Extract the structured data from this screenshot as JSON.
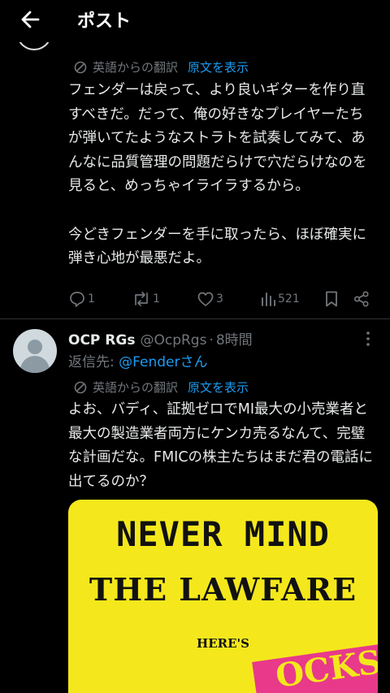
{
  "header": {
    "title": "ポスト"
  },
  "tweet1": {
    "translated_label": "英語からの翻訳",
    "show_original": "原文を表示",
    "text": "フェンダーは戻って、より良いギターを作り直すべきだ。だって、俺の好きなプレイヤーたちが弾いてたようなストラトを試奏してみて、あんなに品質管理の問題だらけで穴だらけなのを見ると、めっちゃイライラするから。\n\n今どきフェンダーを手に取ったら、ほぼ確実に弾き心地が最悪だよ。",
    "actions": {
      "replies": "1",
      "reposts": "1",
      "likes": "3",
      "views": "521"
    }
  },
  "tweet2": {
    "display_name": "OCP RGs",
    "handle": "@OcpRgs",
    "separator": "·",
    "time": "8時間",
    "reply_prefix": "返信先: ",
    "reply_mention": "@Fenderさん",
    "translated_label": "英語からの翻訳",
    "show_original": "原文を表示",
    "text": "よお、バディ、証拠ゼロでMI最大の小売業者と最大の製造業者両方にケンカ売るなんて、完璧な計画だな。FMICの株主たちはまだ君の電話に出てるのか？",
    "media": {
      "line1": "NEVER MIND",
      "line2": "THE LAWFARE",
      "line3": "HERE'S",
      "partial": "OCKS"
    }
  },
  "colors": {
    "background": "#000000",
    "text": "#e7e9ea",
    "muted": "#71767b",
    "link": "#1d9bf0",
    "divider": "#2f3336",
    "media_yellow": "#f4e81c",
    "media_pink": "#e8398a"
  },
  "icons": {
    "back": "arrow-left-icon",
    "translate": "translate-icon",
    "reply": "reply-icon",
    "repost": "repost-icon",
    "like": "heart-icon",
    "views": "views-icon",
    "bookmark": "bookmark-icon",
    "share": "share-icon",
    "more": "more-vertical-icon"
  }
}
